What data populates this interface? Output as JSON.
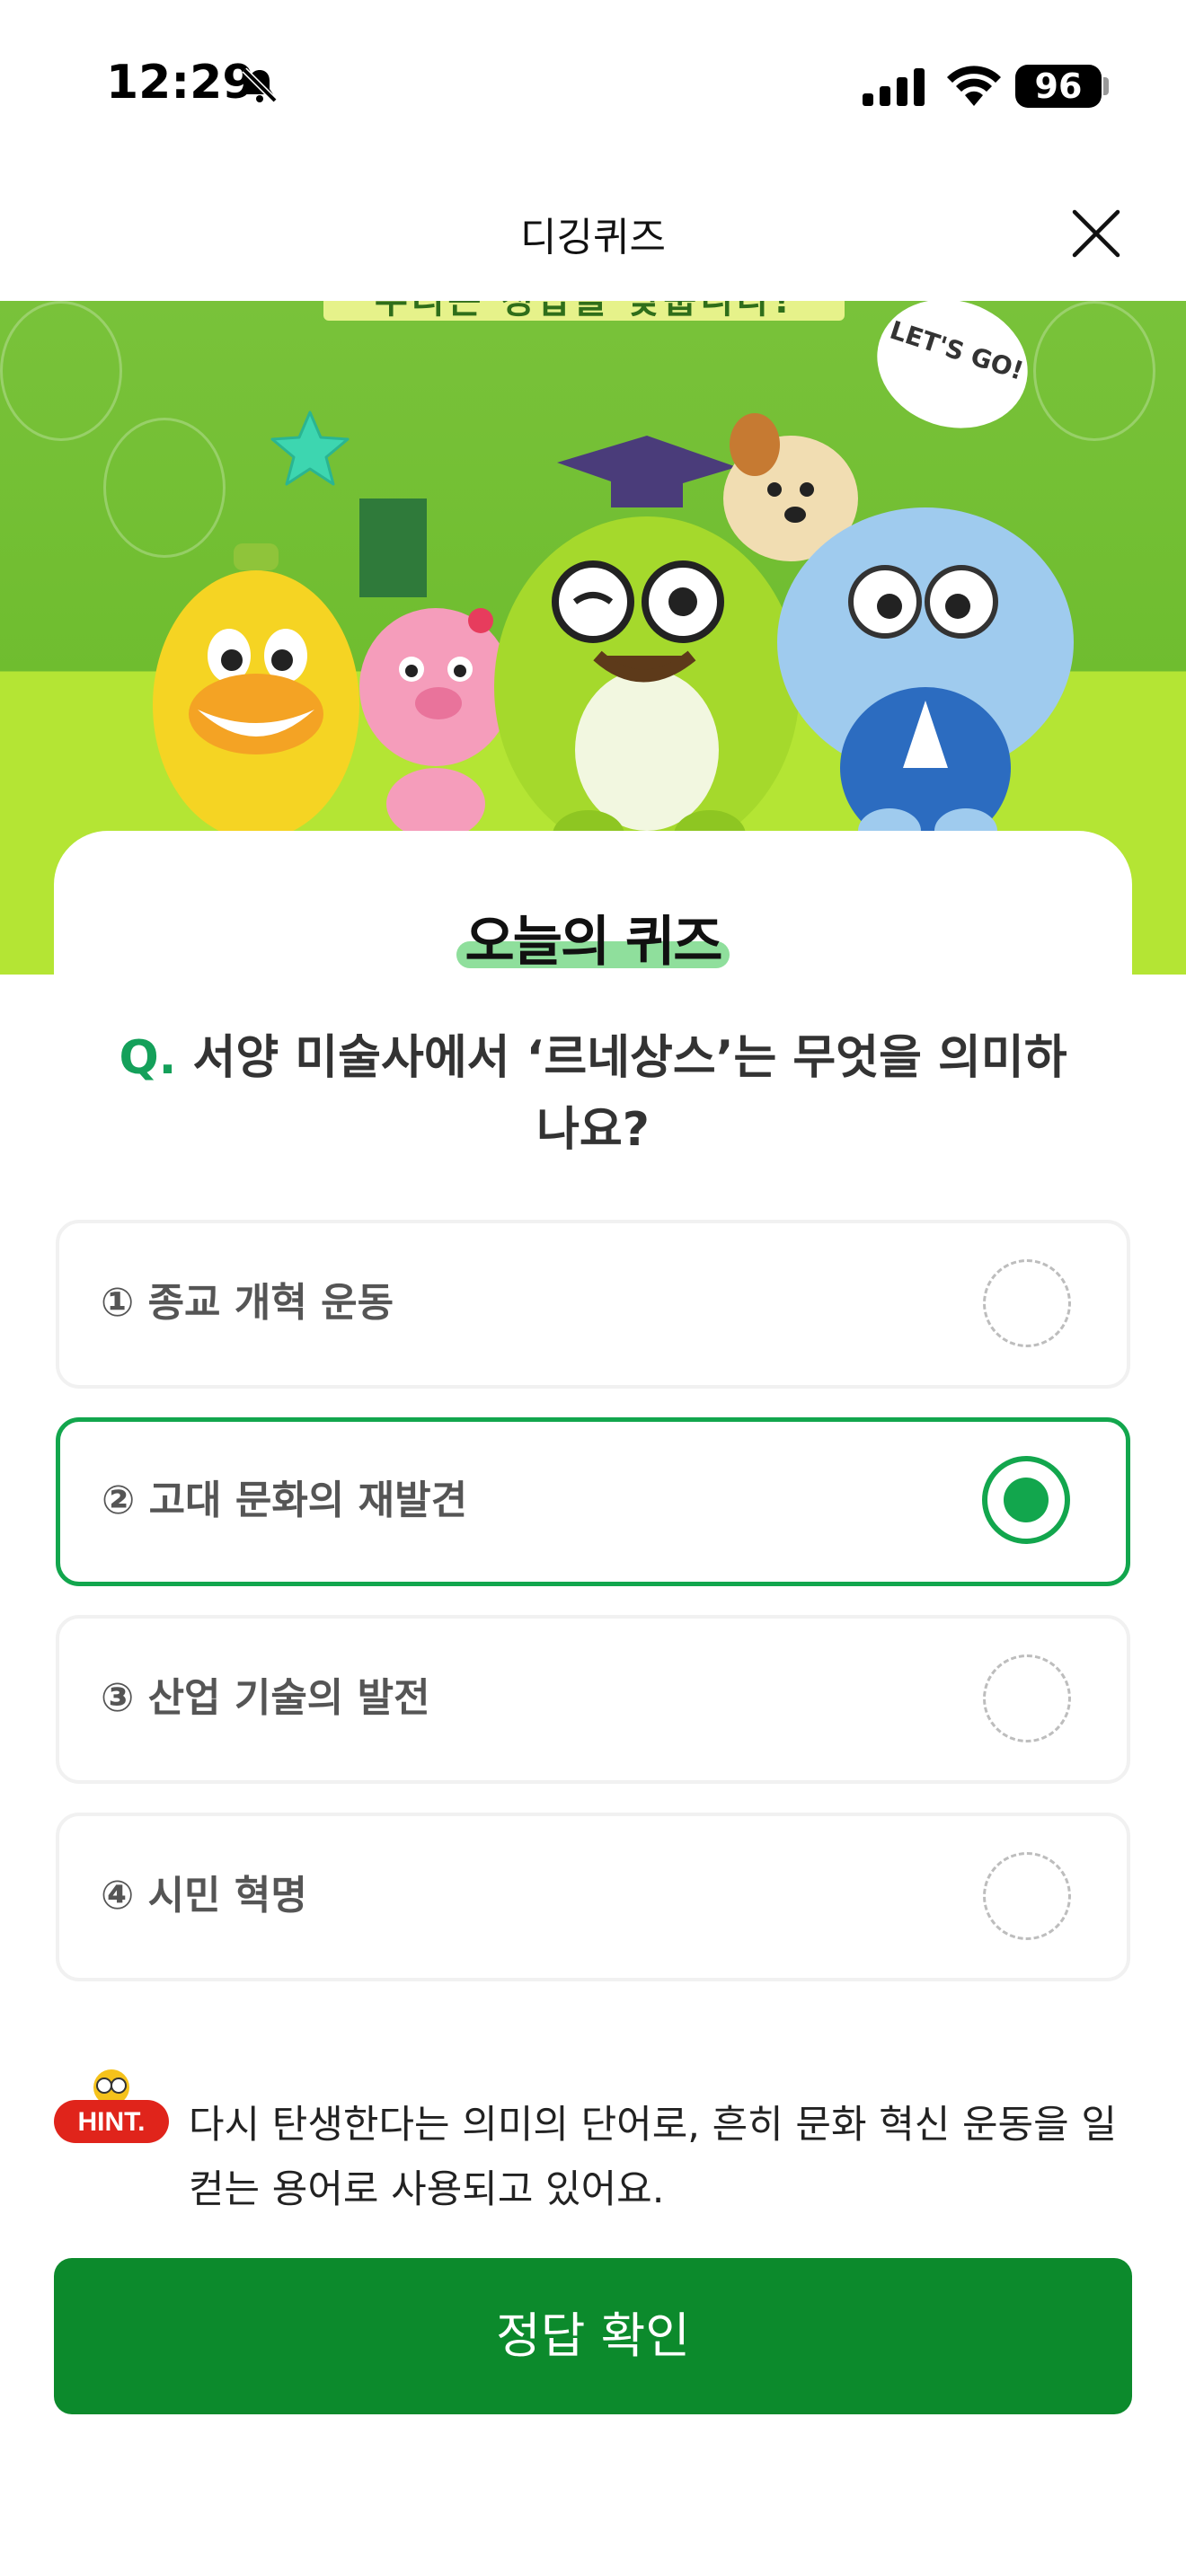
{
  "status_bar": {
    "time": "12:29",
    "battery": "96"
  },
  "nav": {
    "title": "디깅퀴즈"
  },
  "banner": {
    "top_text": "우리는 정답을 맞춥니다!",
    "speech": "LET'S GO!"
  },
  "card": {
    "title": "오늘의 퀴즈"
  },
  "question": {
    "prefix": "Q.",
    "text": "서양 미술사에서 ‘르네상스’는 무엇을 의미하나요?"
  },
  "options": [
    {
      "label": "① 종교 개혁 운동",
      "selected": false
    },
    {
      "label": "② 고대 문화의 재발견",
      "selected": true
    },
    {
      "label": "③ 산업 기술의 발전",
      "selected": false
    },
    {
      "label": "④ 시민 혁명",
      "selected": false
    }
  ],
  "hint": {
    "badge": "HINT.",
    "text": "다시 탄생한다는 의미의 단어로, 흔히 문화 혁신 운동을 일컫는 용어로 사용되고 있어요."
  },
  "submit": {
    "label": "정답 확인"
  },
  "colors": {
    "accent": "#12a64d",
    "button": "#0c8a2c",
    "banner_green": "#79c23a",
    "banner_lime": "#b4e534",
    "hint_red": "#e0241b"
  }
}
